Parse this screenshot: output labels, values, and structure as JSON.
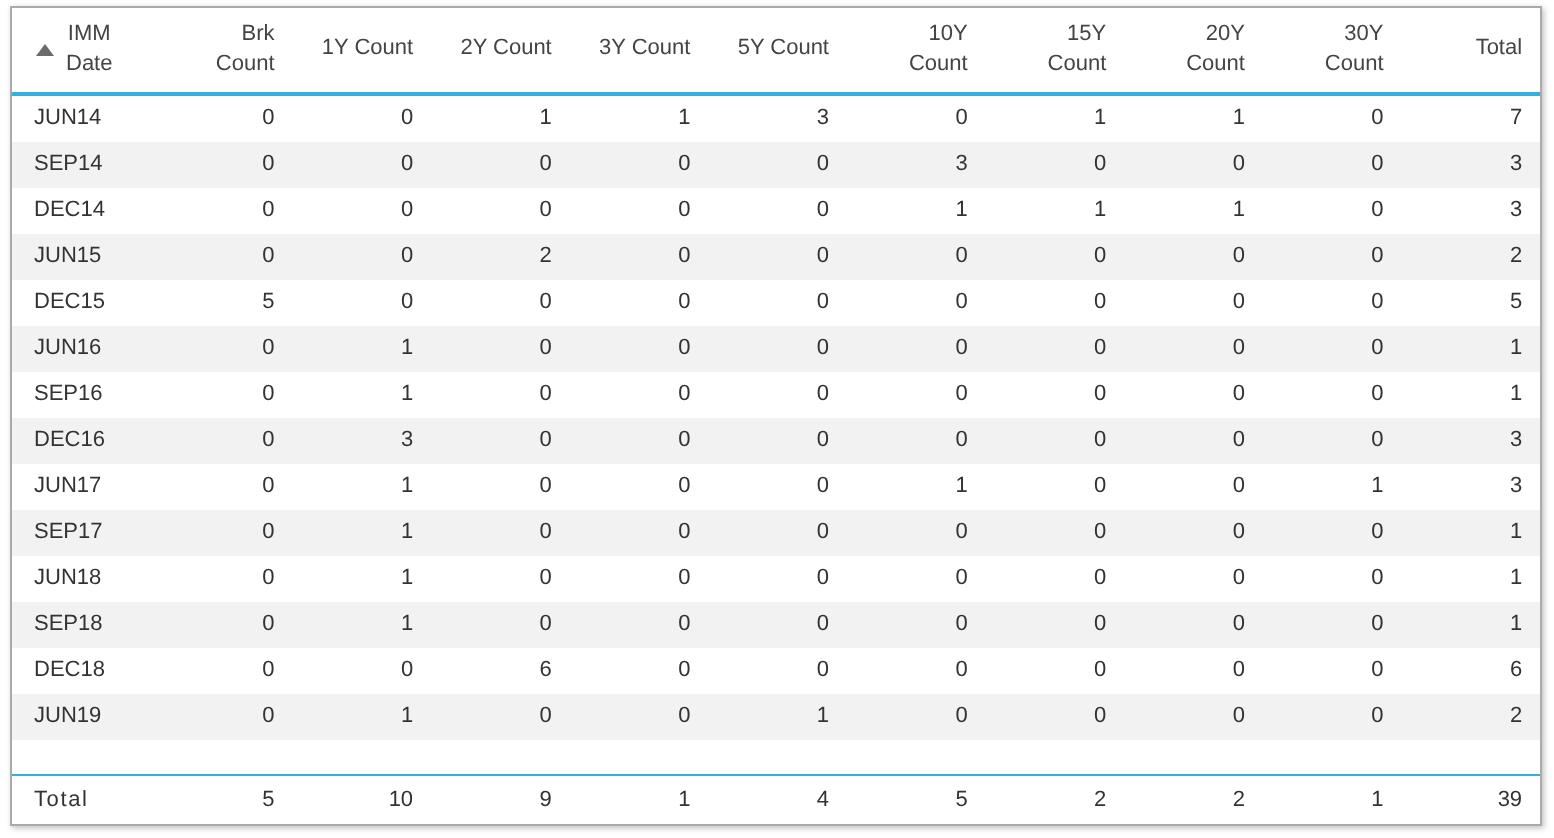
{
  "table": {
    "columns": [
      {
        "lines": [
          "IMM",
          "Date"
        ],
        "sorted": true
      },
      {
        "lines": [
          "Brk",
          "Count"
        ],
        "sorted": false
      },
      {
        "lines": [
          "1Y Count"
        ],
        "sorted": false
      },
      {
        "lines": [
          "2Y Count"
        ],
        "sorted": false
      },
      {
        "lines": [
          "3Y Count"
        ],
        "sorted": false
      },
      {
        "lines": [
          "5Y Count"
        ],
        "sorted": false
      },
      {
        "lines": [
          "10Y",
          "Count"
        ],
        "sorted": false
      },
      {
        "lines": [
          "15Y",
          "Count"
        ],
        "sorted": false
      },
      {
        "lines": [
          "20Y",
          "Count"
        ],
        "sorted": false
      },
      {
        "lines": [
          "30Y",
          "Count"
        ],
        "sorted": false
      },
      {
        "lines": [
          "Total"
        ],
        "sorted": false
      }
    ],
    "rows": [
      [
        "JUN14",
        "0",
        "0",
        "1",
        "1",
        "3",
        "0",
        "1",
        "1",
        "0",
        "7"
      ],
      [
        "SEP14",
        "0",
        "0",
        "0",
        "0",
        "0",
        "3",
        "0",
        "0",
        "0",
        "3"
      ],
      [
        "DEC14",
        "0",
        "0",
        "0",
        "0",
        "0",
        "1",
        "1",
        "1",
        "0",
        "3"
      ],
      [
        "JUN15",
        "0",
        "0",
        "2",
        "0",
        "0",
        "0",
        "0",
        "0",
        "0",
        "2"
      ],
      [
        "DEC15",
        "5",
        "0",
        "0",
        "0",
        "0",
        "0",
        "0",
        "0",
        "0",
        "5"
      ],
      [
        "JUN16",
        "0",
        "1",
        "0",
        "0",
        "0",
        "0",
        "0",
        "0",
        "0",
        "1"
      ],
      [
        "SEP16",
        "0",
        "1",
        "0",
        "0",
        "0",
        "0",
        "0",
        "0",
        "0",
        "1"
      ],
      [
        "DEC16",
        "0",
        "3",
        "0",
        "0",
        "0",
        "0",
        "0",
        "0",
        "0",
        "3"
      ],
      [
        "JUN17",
        "0",
        "1",
        "0",
        "0",
        "0",
        "1",
        "0",
        "0",
        "1",
        "3"
      ],
      [
        "SEP17",
        "0",
        "1",
        "0",
        "0",
        "0",
        "0",
        "0",
        "0",
        "0",
        "1"
      ],
      [
        "JUN18",
        "0",
        "1",
        "0",
        "0",
        "0",
        "0",
        "0",
        "0",
        "0",
        "1"
      ],
      [
        "SEP18",
        "0",
        "1",
        "0",
        "0",
        "0",
        "0",
        "0",
        "0",
        "0",
        "1"
      ],
      [
        "DEC18",
        "0",
        "0",
        "6",
        "0",
        "0",
        "0",
        "0",
        "0",
        "0",
        "6"
      ],
      [
        "JUN19",
        "0",
        "1",
        "0",
        "0",
        "1",
        "0",
        "0",
        "0",
        "0",
        "2"
      ]
    ],
    "totals": [
      "Total",
      "5",
      "10",
      "9",
      "1",
      "4",
      "5",
      "2",
      "2",
      "1",
      "39"
    ]
  }
}
